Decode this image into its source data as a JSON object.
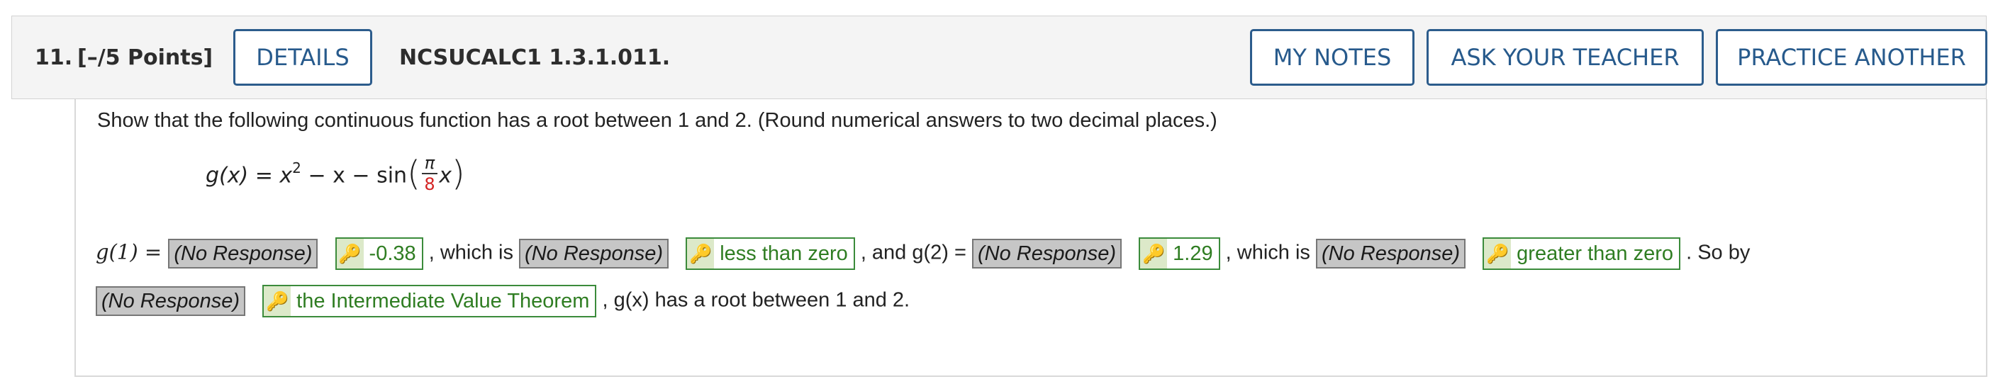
{
  "header": {
    "number": "11.",
    "points": "[–/5 Points]",
    "details_label": "DETAILS",
    "question_id": "NCSUCALC1 1.3.1.011.",
    "my_notes_label": "MY NOTES",
    "ask_teacher_label": "ASK YOUR TEACHER",
    "practice_label": "PRACTICE ANOTHER"
  },
  "prompt": "Show that the following continuous function has a root between 1 and 2. (Round numerical answers to two decimal places.)",
  "formula": {
    "lhs": "g(x) = x",
    "exp": "2",
    "mid": " − x − sin",
    "frac_num": "π",
    "frac_den": "8",
    "var": "x"
  },
  "answers": {
    "g1_label": "g(1) = ",
    "no_response": "(No Response)",
    "g1_value": "-0.38",
    "which_is_1": ", which is",
    "g1_relation": "less than zero",
    "and_g2": ", and g(2) =",
    "g2_value": "1.29",
    "which_is_2": ", which is",
    "g2_relation": "greater than zero",
    "so_by": ". So by",
    "theorem": "the Intermediate Value Theorem",
    "conclusion": ", g(x) has a root between 1 and 2."
  },
  "icons": {
    "key": "key-icon"
  },
  "colors": {
    "accent": "#2c5c8c",
    "correct": "#2f7d22",
    "denominator": "#d42323"
  }
}
